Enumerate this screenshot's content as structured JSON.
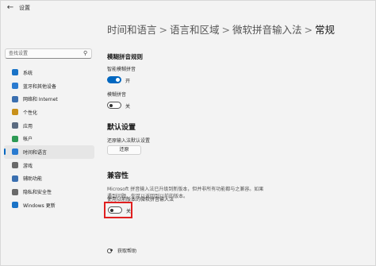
{
  "titlebar": {
    "back_icon": "back-arrow-icon",
    "title": "设置"
  },
  "sidebar": {
    "search_placeholder": "查找设置",
    "items": [
      {
        "label": "系统",
        "icon": "system-icon",
        "color": "#1a73c7"
      },
      {
        "label": "蓝牙和其他设备",
        "icon": "bluetooth-icon",
        "color": "#2a7bd0"
      },
      {
        "label": "网络和 Internet",
        "icon": "network-icon",
        "color": "#3a6fb0"
      },
      {
        "label": "个性化",
        "icon": "personalization-icon",
        "color": "#c8901a"
      },
      {
        "label": "应用",
        "icon": "apps-icon",
        "color": "#5a6a80"
      },
      {
        "label": "帐户",
        "icon": "accounts-icon",
        "color": "#2e9a55"
      },
      {
        "label": "时间和语言",
        "icon": "time-language-icon",
        "color": "#2a7bd0",
        "active": true
      },
      {
        "label": "游戏",
        "icon": "gaming-icon",
        "color": "#6a6a6a"
      },
      {
        "label": "辅助功能",
        "icon": "accessibility-icon",
        "color": "#3a6fb0"
      },
      {
        "label": "隐私和安全性",
        "icon": "privacy-icon",
        "color": "#6a6a6a"
      },
      {
        "label": "Windows 更新",
        "icon": "windows-update-icon",
        "color": "#1a73c7"
      }
    ]
  },
  "breadcrumb": {
    "items": [
      "时间和语言",
      "语言和区域",
      "微软拼音输入法"
    ],
    "current": "常规",
    "separator": ">"
  },
  "fuzzy": {
    "title": "模糊拼音规则",
    "smart_label": "智能模糊拼音",
    "smart_state": "开",
    "fuzzy_label": "模糊拼音",
    "fuzzy_state": "关"
  },
  "defaults": {
    "title": "默认设置",
    "restore_label": "还原输入法默认设置",
    "restore_button": "还原"
  },
  "compat": {
    "title": "兼容性",
    "description": "Microsoft 拼音输入法已升级到新版本，但并非所有功能都与之兼容。如果遇到问题，你可以返回到以前的版本。",
    "prev_label": "使用以前版本的微软拼音输入法",
    "prev_state": "关"
  },
  "help": {
    "label": "获取帮助",
    "icon": "get-help-icon"
  },
  "colors": {
    "accent": "#0067c0",
    "highlight": "#e02020"
  }
}
